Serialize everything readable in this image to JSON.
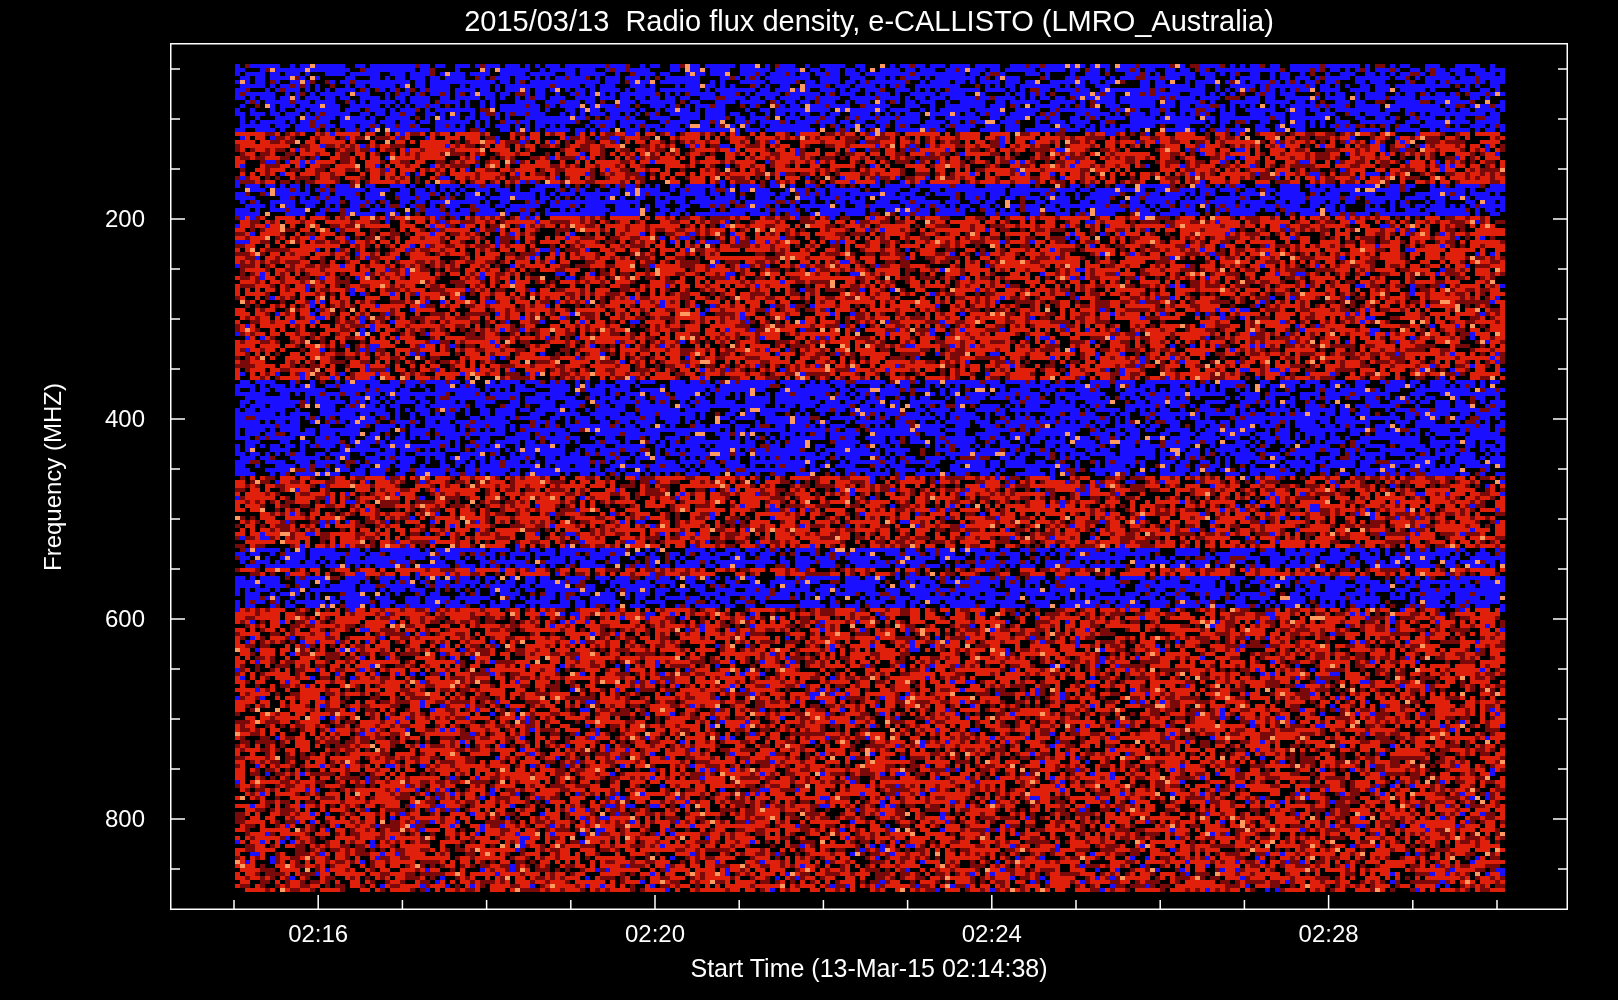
{
  "plot": {
    "title": "2015/03/13  Radio flux density, e-CALLISTO (LMRO_Australia)",
    "xlabel": "Start Time (13-Mar-15 02:14:38)",
    "ylabel": "Frequency (MHZ)",
    "x_tick_labels": [
      "02:16",
      "02:20",
      "02:24",
      "02:28"
    ],
    "y_tick_labels": [
      "200",
      "400",
      "600",
      "800"
    ]
  }
}
